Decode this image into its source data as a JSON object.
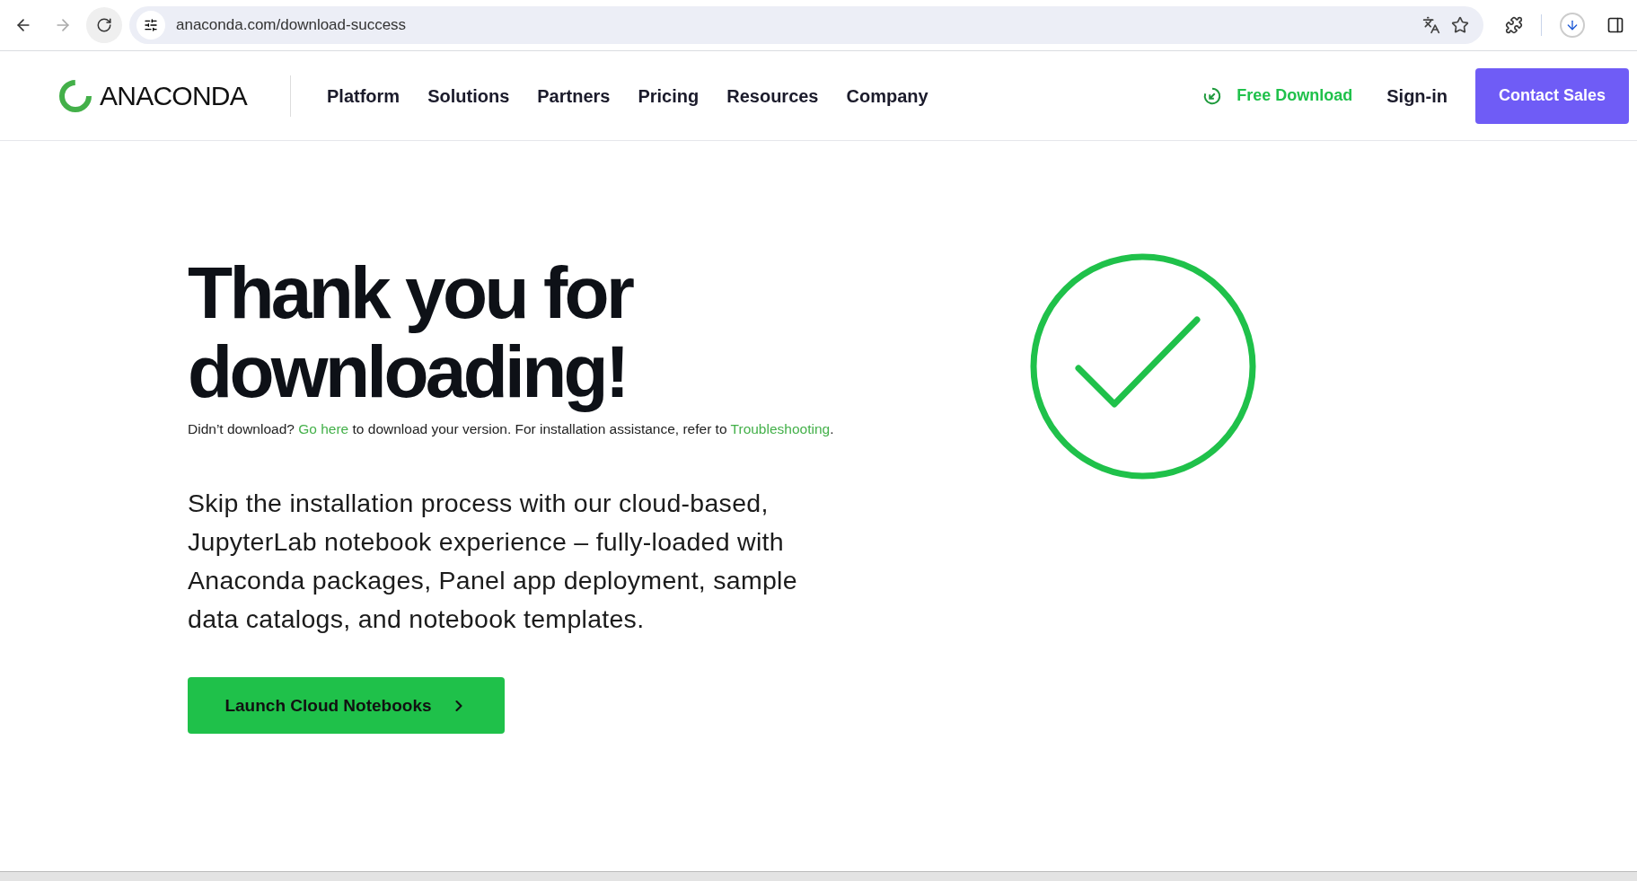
{
  "browser": {
    "url": "anaconda.com/download-success"
  },
  "nav": {
    "logo": "ANACONDA",
    "links": [
      "Platform",
      "Solutions",
      "Partners",
      "Pricing",
      "Resources",
      "Company"
    ],
    "free_download": "Free Download",
    "sign_in": "Sign-in",
    "contact": "Contact Sales"
  },
  "hero": {
    "title_lines": [
      "Thank you for",
      "downloading!"
    ],
    "note": [
      {
        "kind": "text",
        "text": "Didn’t download? "
      },
      {
        "kind": "link",
        "text": "Go here"
      },
      {
        "kind": "text",
        "text": " to download your version. For installation assistance, refer to "
      },
      {
        "kind": "link",
        "text": "Troubleshooting"
      },
      {
        "kind": "text",
        "text": "."
      }
    ],
    "body": "Skip the installation process with our cloud-based, JupyterLab notebook experience – fully-loaded with Anaconda packages, Panel app deployment, sample data catalogs, and notebook templates.",
    "button": "Launch Cloud Notebooks"
  }
}
